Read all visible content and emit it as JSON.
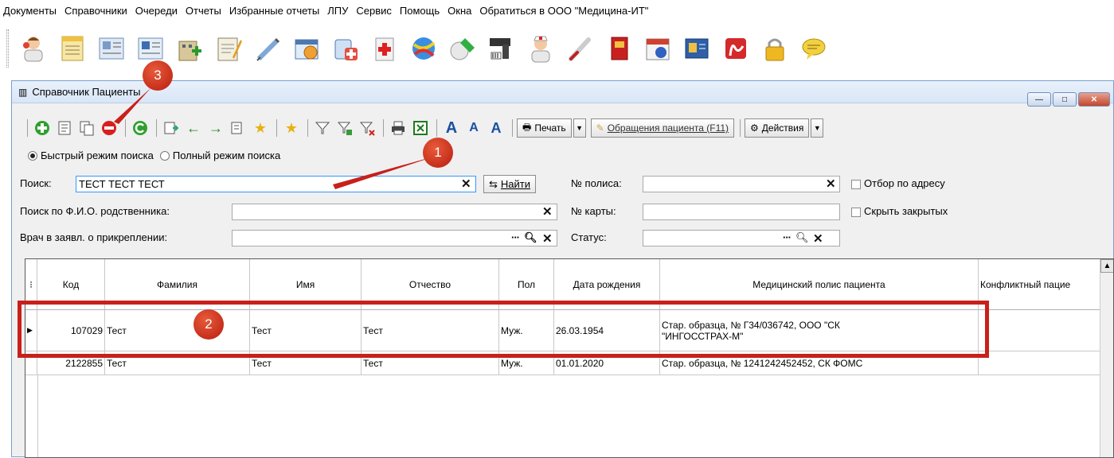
{
  "menu": [
    "Документы",
    "Справочники",
    "Очереди",
    "Отчеты",
    "Избранные отчеты",
    "ЛПУ",
    "Сервис",
    "Помощь",
    "Окна",
    "Обратиться в ООО \"Медицина-ИТ\""
  ],
  "main_toolbar_icons": [
    "doctor-icon",
    "notebook-icon",
    "card-file-icon",
    "card-file-2-icon",
    "hospital-icon",
    "notepad-icon",
    "syringe-icon",
    "schedule-icon",
    "pharmacy-icon",
    "first-aid-icon",
    "ball-icon",
    "pills-icon",
    "barcode-scanner-icon",
    "nurse-icon",
    "thermometer-icon",
    "red-book-icon",
    "calendar-icon",
    "card-icon",
    "pdf-icon",
    "lock-icon",
    "message-icon"
  ],
  "window": {
    "title": "Справочник Пациенты",
    "buttons": {
      "minimize": "—",
      "maximize": "□",
      "close": "✕"
    }
  },
  "window_toolbar": {
    "print_label": "Печать",
    "appeals_label": "Обращения пациента (F11)",
    "actions_label": "Действия"
  },
  "search_mode": {
    "quick": "Быстрый режим поиска",
    "full": "Полный режим поиска",
    "selected": "quick"
  },
  "form": {
    "search_label": "Поиск:",
    "search_value": "ТЕСТ ТЕСТ ТЕСТ",
    "find_label": "Найти",
    "relative_label": "Поиск по Ф.И.О. родственника:",
    "relative_value": "",
    "doctor_label": "Врач в заявл. о прикреплении:",
    "doctor_value": "",
    "policy_label": "№ полиса:",
    "policy_value": "",
    "card_label": "№ карты:",
    "card_value": "",
    "status_label": "Статус:",
    "status_value": "",
    "filter_address_label": "Отбор по адресу",
    "hide_closed_label": "Скрыть закрытых"
  },
  "grid": {
    "columns": [
      "Код",
      "Фамилия",
      "Имя",
      "Отчество",
      "Пол",
      "Дата рождения",
      "Медицинский полис пациента",
      "Конфликтный пацие"
    ],
    "rows": [
      {
        "code": "107029",
        "last": "Тест",
        "first": "Тест",
        "middle": "Тест",
        "sex": "Муж.",
        "dob": "26.03.1954",
        "policy_line1": "Стар. образца, № Г34/036742, ООО \"СК",
        "policy_line2": "\"ИНГОССТРАХ-М\"",
        "conflict": ""
      },
      {
        "code": "2122855",
        "last": "Тест",
        "first": "Тест",
        "middle": "Тест",
        "sex": "Муж.",
        "dob": "01.01.2020",
        "policy_line1": "Стар. образца, № 1241242452452, СК ФОМС",
        "policy_line2": "",
        "conflict": ""
      }
    ]
  },
  "annotations": [
    "1",
    "2",
    "3"
  ],
  "colors": {
    "annotation": "#c8201a",
    "window_border": "#7aa0cf"
  }
}
